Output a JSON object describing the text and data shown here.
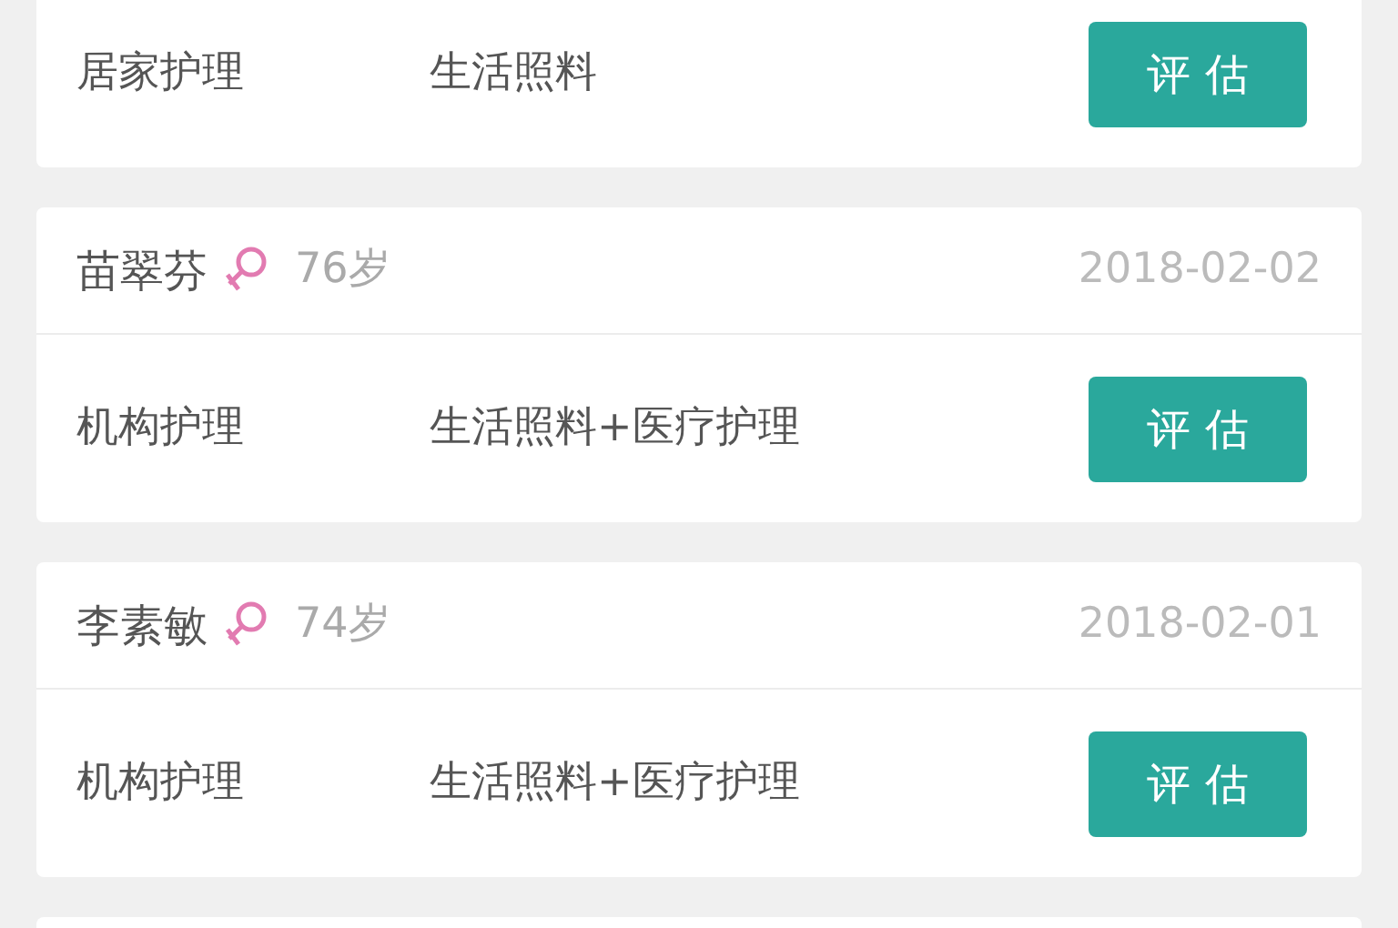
{
  "records": [
    {
      "care_type": "居家护理",
      "service": "生活照料",
      "button": "评 估"
    },
    {
      "name": "苗翠芬",
      "female": true,
      "age": "76岁",
      "date": "2018-02-02",
      "care_type": "机构护理",
      "service": "生活照料+医疗护理",
      "button": "评 估"
    },
    {
      "name": "李素敏",
      "female": true,
      "age": "74岁",
      "date": "2018-02-01",
      "care_type": "机构护理",
      "service": "生活照料+医疗护理",
      "button": "评 估"
    }
  ]
}
